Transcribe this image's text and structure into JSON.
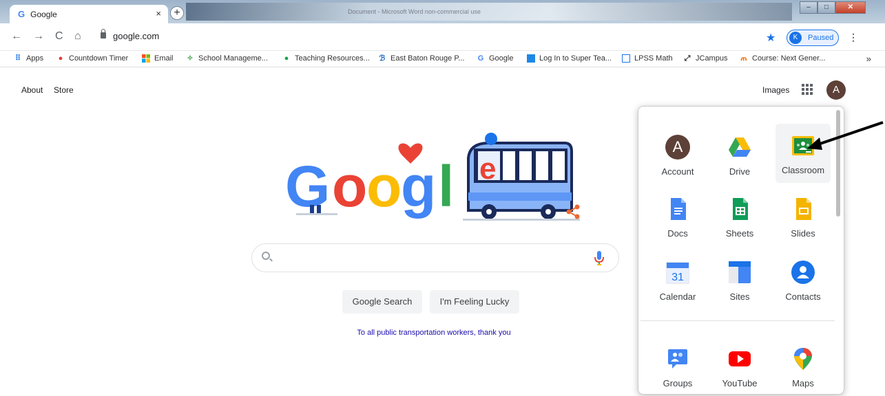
{
  "browser": {
    "tab_title": "Google",
    "tab_close": "×",
    "new_tab": "+",
    "background_text": "Document - Microsoft Word non-commercial use",
    "address": "google.com",
    "profile_initial": "K",
    "profile_status": "Paused",
    "bookmarks": [
      {
        "label": "Apps",
        "icon": "apps-grid-icon",
        "color": "#1a73e8"
      },
      {
        "label": "Countdown Timer",
        "icon": "countdown-timer-icon",
        "color": "#e53935"
      },
      {
        "label": "Email",
        "icon": "microsoft-icon",
        "color": "#f25022"
      },
      {
        "label": "School Manageme...",
        "icon": "school-icon",
        "color": "#43a047"
      },
      {
        "label": "Teaching Resources...",
        "icon": "teaching-resources-icon",
        "color": "#16a34a"
      },
      {
        "label": "East Baton Rouge P...",
        "icon": "ebr-icon",
        "color": "#1565c0"
      },
      {
        "label": "Google",
        "icon": "google-icon",
        "color": "#4285f4"
      },
      {
        "label": "Log In to Super Tea...",
        "icon": "super-teacher-icon",
        "color": "#1e88e5"
      },
      {
        "label": "LPSS Math",
        "icon": "lpss-math-icon",
        "color": "#1a73e8"
      },
      {
        "label": "JCampus",
        "icon": "jcampus-icon",
        "color": "#333333"
      },
      {
        "label": "Course: Next Gener...",
        "icon": "course-icon",
        "color": "#ef6c00"
      }
    ],
    "bookmarks_more": "»"
  },
  "google": {
    "about": "About",
    "store": "Store",
    "images": "Images",
    "avatar_initial": "A",
    "search_button": "Google Search",
    "lucky_button": "I'm Feeling Lucky",
    "promo": "To all public transportation workers, thank you",
    "doodle_letters": [
      "G",
      "o",
      "o",
      "g",
      "l",
      "e"
    ]
  },
  "apps_panel": {
    "apps": [
      {
        "label": "Account",
        "icon": "account-icon",
        "initial": "A"
      },
      {
        "label": "Drive",
        "icon": "drive-icon"
      },
      {
        "label": "Classroom",
        "icon": "classroom-icon",
        "selected": true
      },
      {
        "label": "Docs",
        "icon": "docs-icon"
      },
      {
        "label": "Sheets",
        "icon": "sheets-icon"
      },
      {
        "label": "Slides",
        "icon": "slides-icon"
      },
      {
        "label": "Calendar",
        "icon": "calendar-icon",
        "day": "31"
      },
      {
        "label": "Sites",
        "icon": "sites-icon"
      },
      {
        "label": "Contacts",
        "icon": "contacts-icon"
      },
      {
        "label": "Groups",
        "icon": "groups-icon"
      },
      {
        "label": "YouTube",
        "icon": "youtube-icon"
      },
      {
        "label": "Maps",
        "icon": "maps-icon"
      }
    ]
  },
  "colors": {
    "google_blue": "#4285f4",
    "google_red": "#ea4335",
    "google_yellow": "#fbbc05",
    "google_green": "#34a853"
  }
}
